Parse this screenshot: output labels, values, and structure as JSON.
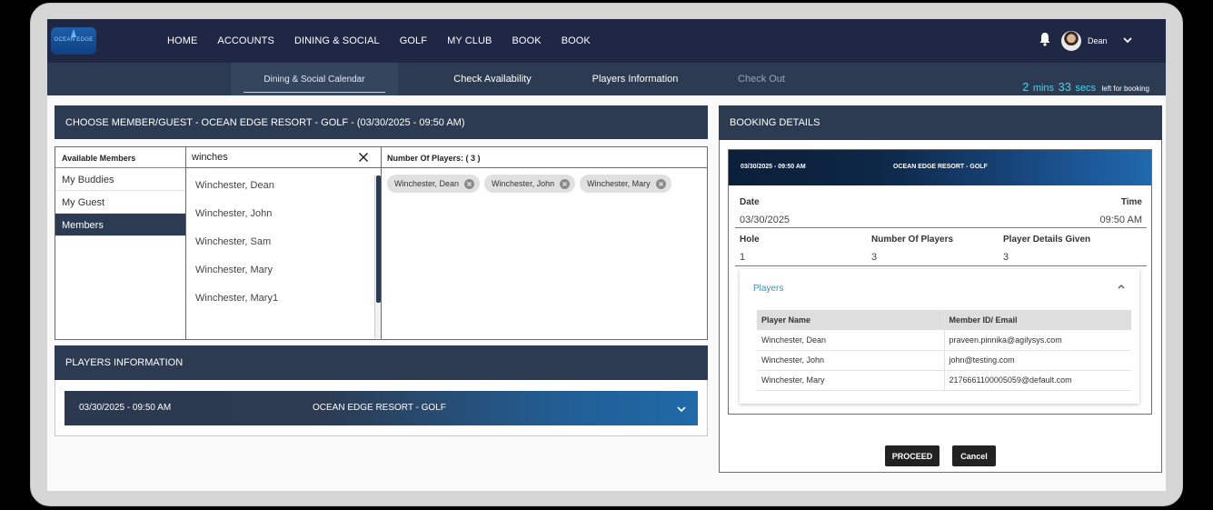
{
  "brand": {
    "logo_text": "OCEAN EDGE"
  },
  "nav": {
    "items": [
      "HOME",
      "ACCOUNTS",
      "DINING & SOCIAL",
      "GOLF",
      "MY CLUB",
      "BOOK",
      "BOOK"
    ],
    "user_name": "Dean",
    "icons": {
      "notifications": "bell-icon",
      "user_menu": "chevron-down-icon"
    }
  },
  "steps": {
    "items": [
      "Dining & Social Calendar",
      "Check Availability",
      "Players Information",
      "Check Out"
    ],
    "active_index": 0
  },
  "timer": {
    "minutes": "2",
    "min_unit": "mins",
    "seconds": "33",
    "sec_unit": "secs",
    "suffix": "left for booking",
    "accent_color": "#41d7ef"
  },
  "choose": {
    "title": "CHOOSE MEMBER/GUEST - OCEAN EDGE RESORT - GOLF - (03/30/2025 - 09:50 AM)",
    "categories_header": "Available Members",
    "categories": [
      "My Buddies",
      "My Guest",
      "Members"
    ],
    "active_category": "Members",
    "search_value": "winches",
    "results": [
      "Winchester, Dean",
      "Winchester, John",
      "Winchester, Sam",
      "Winchester, Mary",
      "Winchester, Mary1"
    ],
    "selected_header": "Number Of Players: ( 3 )",
    "selected": [
      "Winchester, Dean",
      "Winchester, John",
      "Winchester, Mary"
    ]
  },
  "players_info": {
    "title": "PLAYERS INFORMATION",
    "bar_datetime": "03/30/2025 - 09:50 AM",
    "bar_resort": "OCEAN EDGE RESORT - GOLF"
  },
  "booking": {
    "title": "BOOKING DETAILS",
    "card_datetime": "03/30/2025 - 09:50 AM",
    "card_resort": "OCEAN EDGE RESORT - GOLF",
    "date_label": "Date",
    "date_value": "03/30/2025",
    "time_label": "Time",
    "time_value": "09:50 AM",
    "hole_label": "Hole",
    "hole_value": "1",
    "num_players_label": "Number Of Players",
    "num_players_value": "3",
    "details_given_label": "Player Details Given",
    "details_given_value": "3",
    "players_title": "Players",
    "columns": [
      "Player Name",
      "Member ID/ Email"
    ],
    "rows": [
      [
        "Winchester, Dean",
        "praveen.pinnika@agilysys.com"
      ],
      [
        "Winchester, John",
        "john@testing.com"
      ],
      [
        "Winchester, Mary",
        "2176661100005059@default.com"
      ]
    ]
  },
  "actions": {
    "proceed": "PROCEED",
    "cancel": "Cancel"
  }
}
